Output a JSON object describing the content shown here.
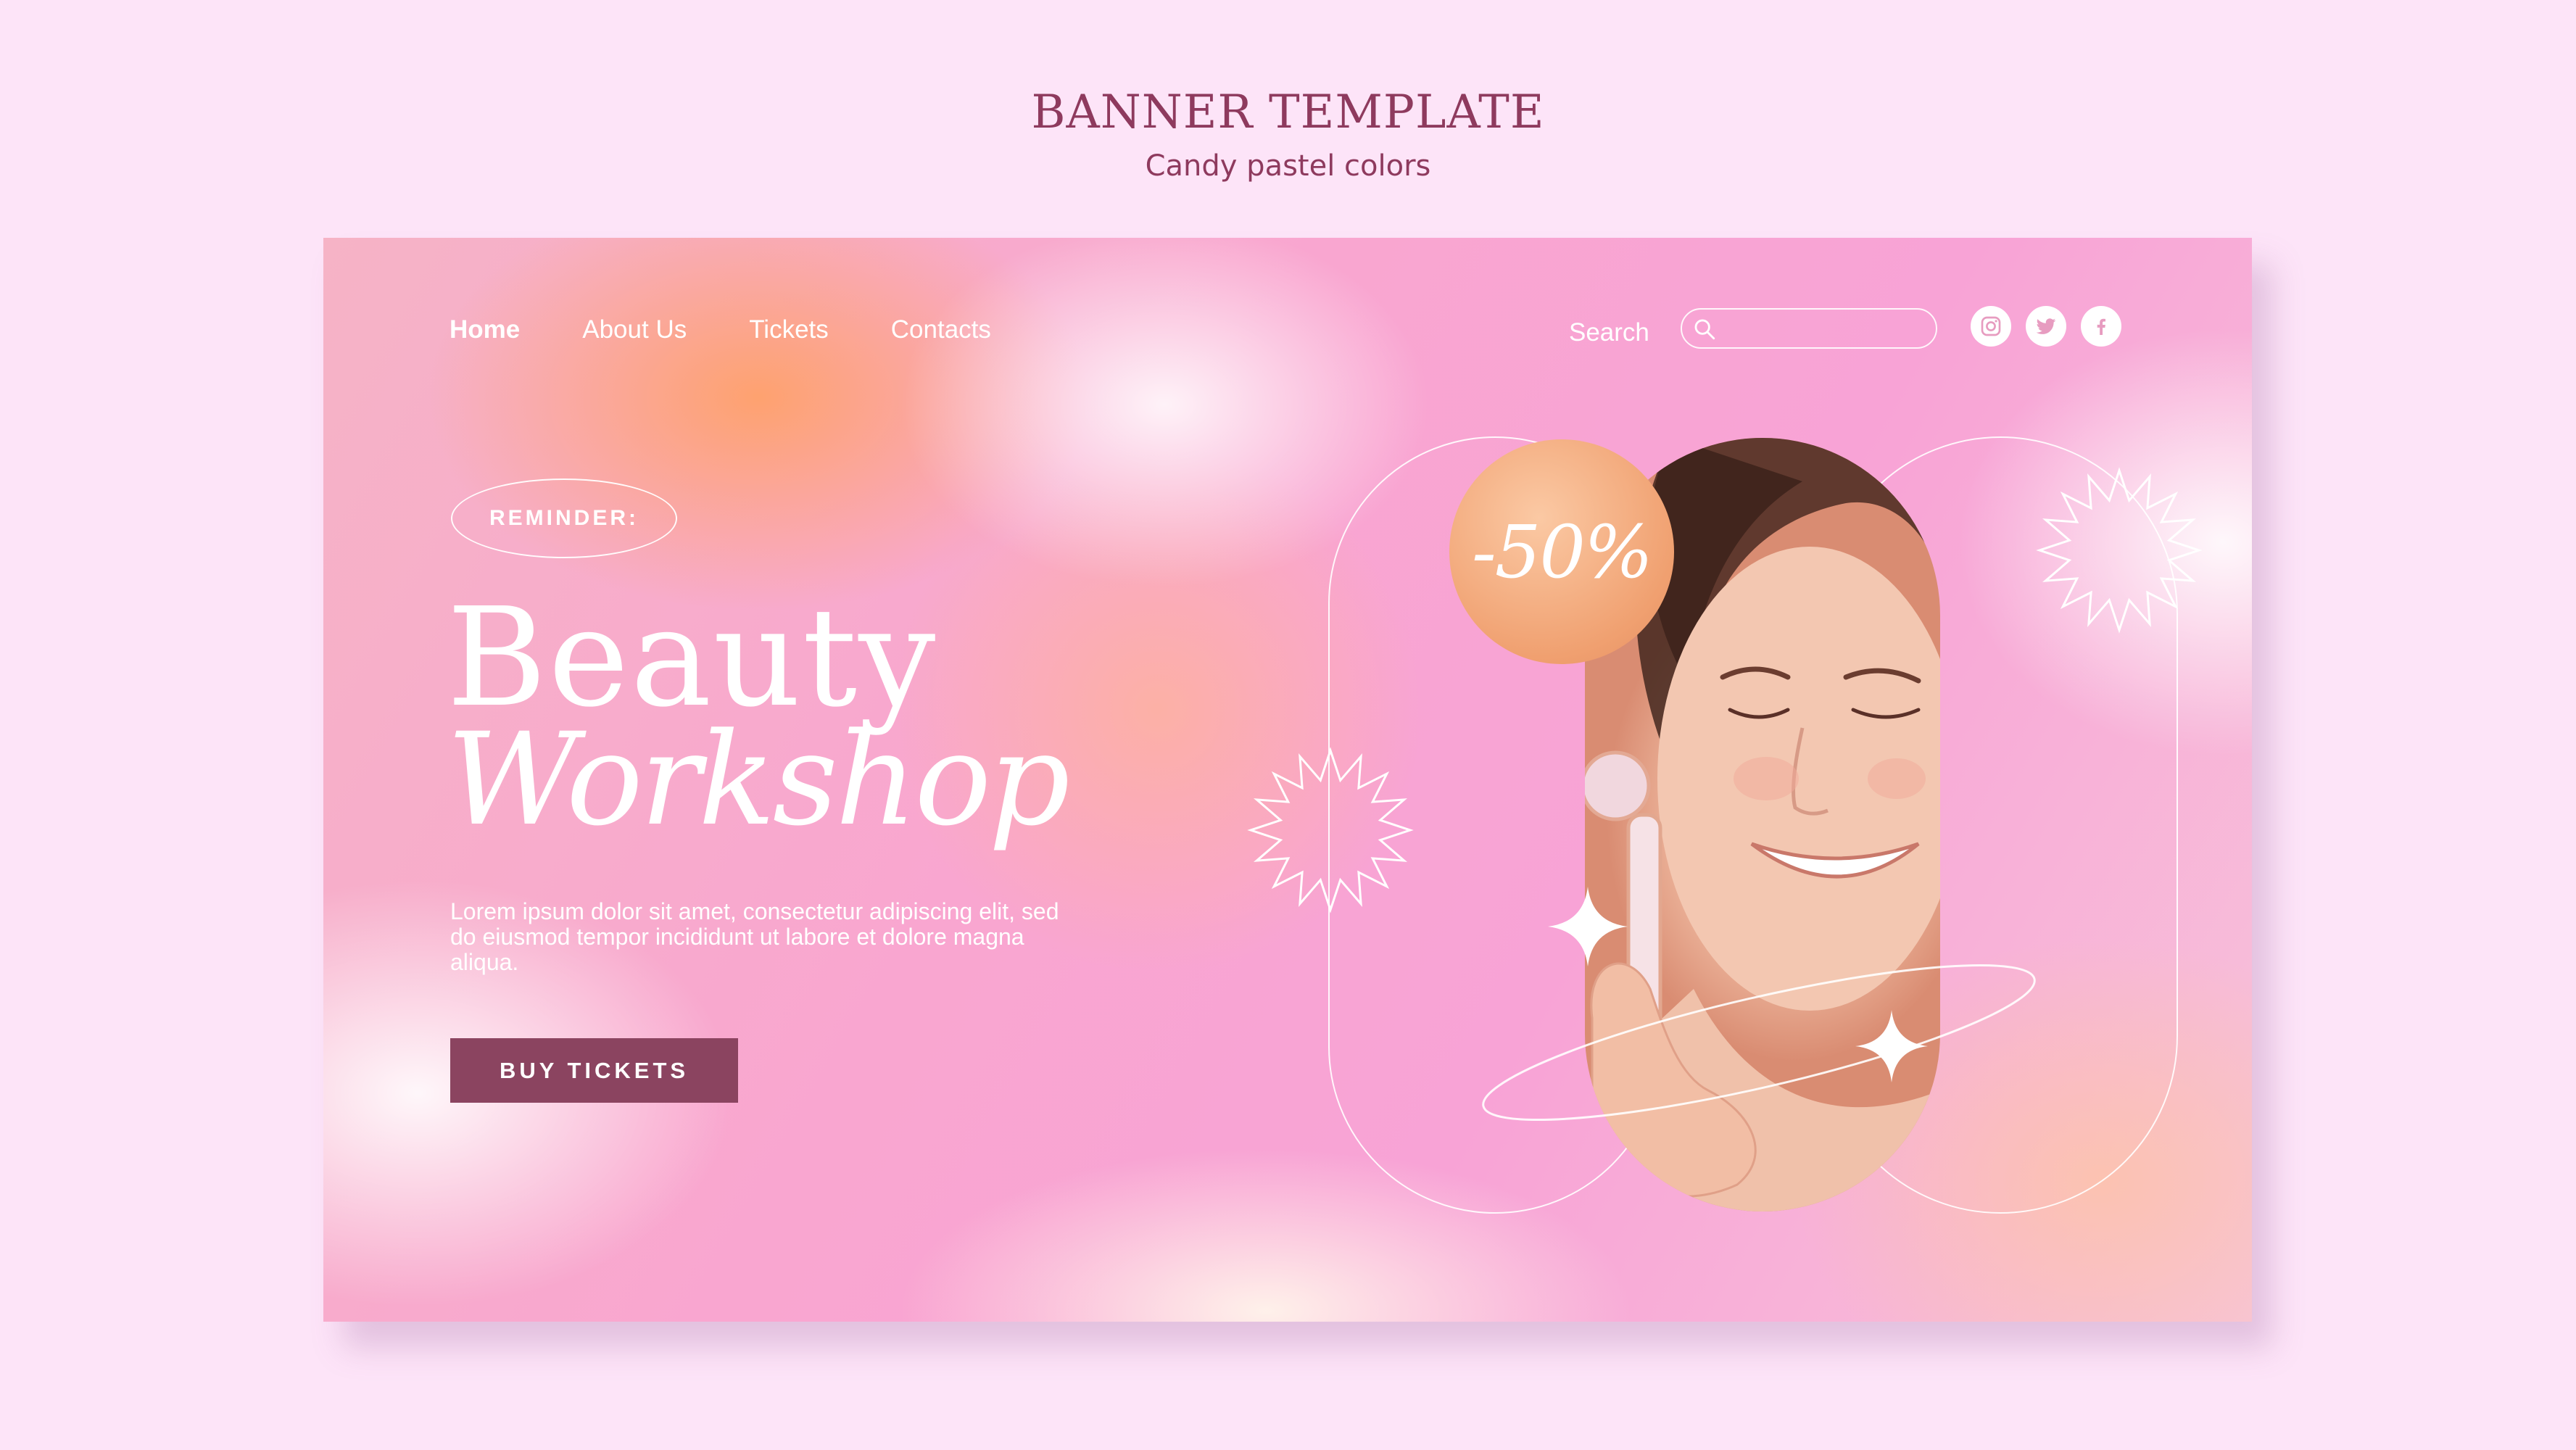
{
  "page": {
    "title": "BANNER TEMPLATE",
    "subtitle": "Candy pastel colors"
  },
  "nav": {
    "items": [
      {
        "label": "Home",
        "active": true
      },
      {
        "label": "About Us",
        "active": false
      },
      {
        "label": "Tickets",
        "active": false
      },
      {
        "label": "Contacts",
        "active": false
      }
    ]
  },
  "search": {
    "label": "Search",
    "value": "",
    "placeholder": ""
  },
  "social": [
    {
      "icon": "instagram-icon"
    },
    {
      "icon": "twitter-icon"
    },
    {
      "icon": "facebook-icon"
    }
  ],
  "hero": {
    "reminder": "REMINDER:",
    "title_line1": "Beauty",
    "title_line2": "Workshop",
    "body": "Lorem ipsum dolor sit amet, consectetur adipiscing elit, sed do eiusmod tempor incididunt ut labore et dolore magna aliqua.",
    "button_label": "BUY TICKETS"
  },
  "promo": {
    "discount": "-50%"
  },
  "colors": {
    "page_background": "#fde4f8",
    "heading": "#8e3a5e",
    "button": "#8b4460",
    "discount_badge": "#f0a070"
  }
}
